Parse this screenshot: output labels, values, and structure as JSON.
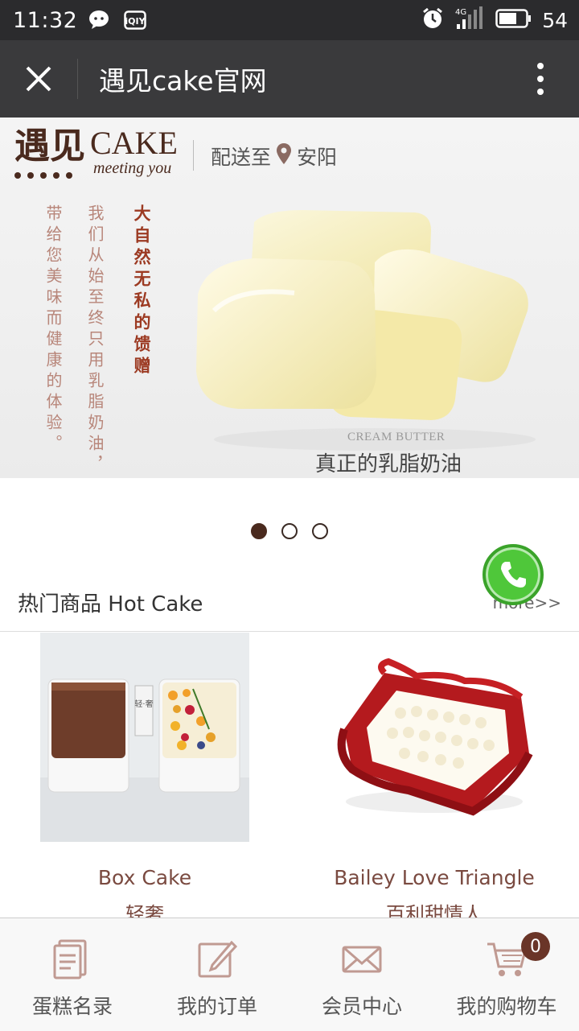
{
  "status_bar": {
    "time": "11:32",
    "network": "4G",
    "battery": "54",
    "icons": [
      "wechat-icon",
      "iqiyi-icon",
      "alarm-icon",
      "signal-icon",
      "battery-icon"
    ],
    "iqiyi_label": "iQIY"
  },
  "titlebar": {
    "title": "遇见cake官网",
    "close_icon": "close-icon",
    "more_icon": "more-vertical-icon"
  },
  "banner": {
    "brand_cn": "遇见",
    "brand_en": "CAKE",
    "brand_sub": "meeting you",
    "delivery_label": "配送至",
    "city": "安阳",
    "column1": "带给您美味而健康的体验。",
    "column2": "我们从始至终只用乳脂奶油，",
    "column3": "大自然无私的馈赠",
    "caption_en": "CREAM BUTTER",
    "caption_cn": "真正的乳脂奶油",
    "slides": 3,
    "active_slide": 1
  },
  "hot": {
    "title": "热门商品 Hot Cake",
    "more": "more>>"
  },
  "products": [
    {
      "name_en": "Box Cake",
      "name_cn": "轻奢",
      "box_label": "轻·奢"
    },
    {
      "name_en": "Bailey Love Triangle",
      "name_cn": "百利甜情人"
    }
  ],
  "nav": [
    {
      "label": "蛋糕名录",
      "icon": "catalog-icon"
    },
    {
      "label": "我的订单",
      "icon": "edit-order-icon"
    },
    {
      "label": "会员中心",
      "icon": "envelope-icon"
    },
    {
      "label": "我的购物车",
      "icon": "cart-icon"
    }
  ],
  "cart_count": "0",
  "colors": {
    "brand_brown": "#4a2a1e",
    "accent_red": "#9c3a22",
    "phone_green": "#4fc73a"
  }
}
